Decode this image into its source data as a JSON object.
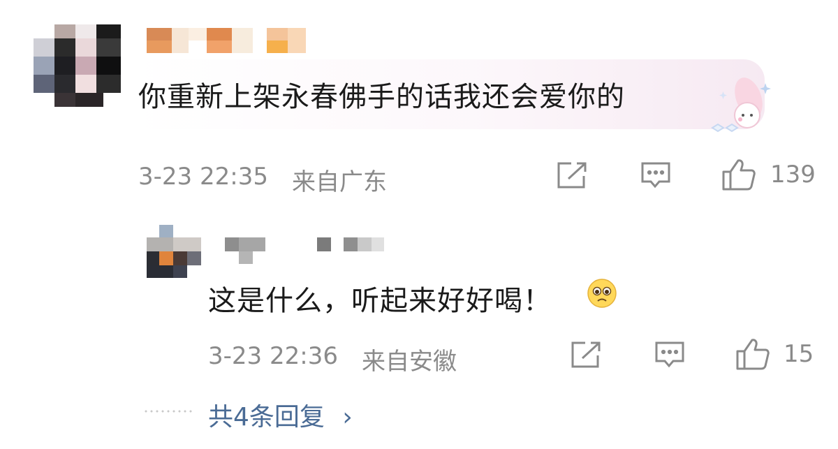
{
  "comments": [
    {
      "text": "你重新上架永春佛手的话我还会爱你的",
      "time": "3-23 22:35",
      "location": "来自广东",
      "likes": "139"
    },
    {
      "text": "这是什么，听起来好好喝！",
      "time": "3-23 22:36",
      "location": "来自安徽",
      "likes": "15"
    }
  ],
  "more_replies": "共4条回复",
  "more_chevron": "›",
  "icons": {
    "share": "share-icon",
    "comment": "comment-icon",
    "like": "thumbs-up-icon",
    "emoji": "pleading-face-emoji",
    "sticker": "melody-sticker"
  },
  "colors": {
    "text": "#1a1a1a",
    "meta": "#8a8a8a",
    "link": "#4a6b95"
  }
}
